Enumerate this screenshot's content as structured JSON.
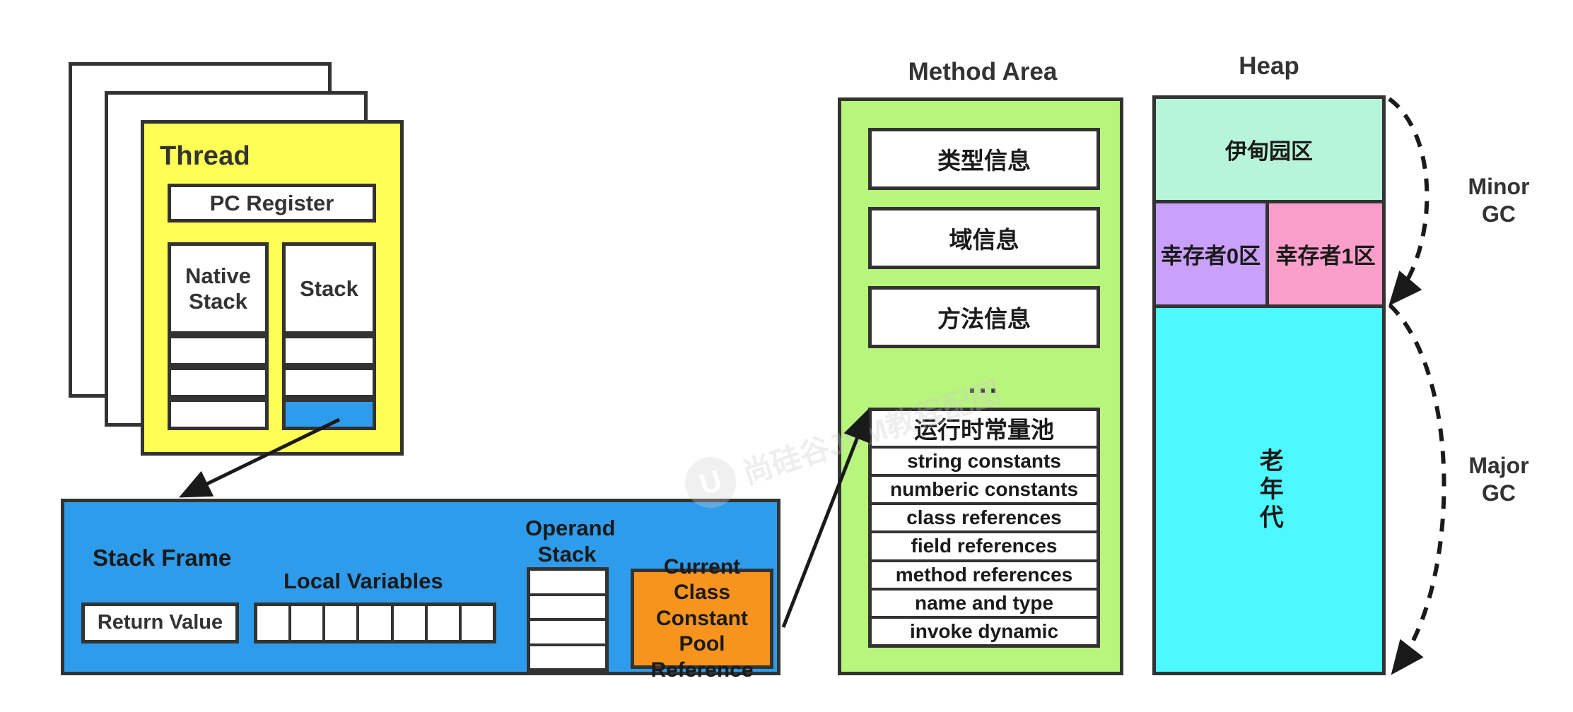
{
  "thread": {
    "title": "Thread",
    "pc_register": "PC Register",
    "native_stack": "Native\nStack",
    "native_stack_label": "Native Stack",
    "stack_label": "Stack",
    "native_stack_empty_rows": 3,
    "stack_empty_rows": 2,
    "highlighted_frame_color": "#2f9ceb",
    "card_count": 3,
    "box_color": "#ffff55"
  },
  "stack_frame": {
    "title": "Stack Frame",
    "return_value": "Return Value",
    "local_variables_label": "Local Variables",
    "local_variable_cells": 7,
    "operand_stack_label": "Operand\nStack",
    "operand_stack_label_line1": "Operand",
    "operand_stack_label_line2": "Stack",
    "operand_stack_cells": 4,
    "constant_pool_reference": "Current Class Constant Pool Reference",
    "constant_pool_reference_line1": "Current Class",
    "constant_pool_reference_line2": "Constant Pool",
    "constant_pool_reference_line3": "Reference",
    "box_color": "#2f9ceb",
    "ccpr_color": "#f7941e"
  },
  "method_area": {
    "title": "Method Area",
    "box_color": "#b8f57d",
    "items": [
      {
        "label": "类型信息"
      },
      {
        "label": "域信息"
      },
      {
        "label": "方法信息"
      }
    ],
    "ellipsis": "...",
    "constant_pool": {
      "header": "运行时常量池",
      "rows": [
        "string constants",
        "numberic constants",
        "class references",
        "field references",
        "method references",
        "name and type",
        "invoke dynamic"
      ]
    }
  },
  "heap": {
    "title": "Heap",
    "regions": [
      {
        "label": "伊甸园区",
        "color": "#b7f5da"
      },
      {
        "label": "幸存者0区",
        "color": "#c9a0fb"
      },
      {
        "label": "幸存者1区",
        "color": "#fb9fca"
      },
      {
        "label": "老年代",
        "color": "#4df9ff"
      }
    ],
    "eden": "伊甸园区",
    "survivor0": "幸存者0区",
    "survivor1": "幸存者1区",
    "old_gen": "老年代",
    "old_gen_chars": [
      "老",
      "年",
      "代"
    ]
  },
  "gc": {
    "minor_line1": "Minor",
    "minor_line2": "GC",
    "major_line1": "Major",
    "major_line2": "GC"
  },
  "watermark": {
    "logo_glyph": "U",
    "text": "尚硅谷JVM教程配图"
  }
}
